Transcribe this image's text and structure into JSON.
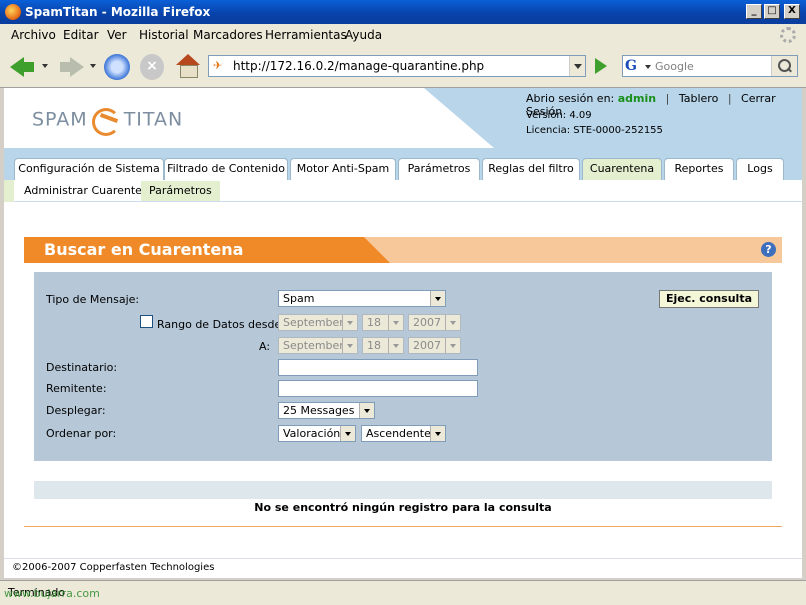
{
  "window": {
    "title": "SpamTitan - Mozilla Firefox",
    "minimize": "_",
    "maximize": "□",
    "close": "X"
  },
  "menu": {
    "items": [
      "Archivo",
      "Editar",
      "Ver",
      "Historial",
      "Marcadores",
      "Herramientas",
      "Ayuda"
    ]
  },
  "navigation": {
    "url": "http://172.16.0.2/manage-quarantine.php",
    "search_placeholder": "Google",
    "search_engine_letter": "G"
  },
  "header": {
    "logo_left": "SPAM",
    "logo_right": "TITAN",
    "session_label": "Abrio sesión en:",
    "user": "admin",
    "link_dashboard": "Tablero",
    "link_logout": "Cerrar Sesión",
    "version": "Versión: 4.09",
    "license": "Licencia: STE-0000-252155"
  },
  "tabs": [
    {
      "label": "Configuración de Sistema",
      "active": false
    },
    {
      "label": "Filtrado de Contenido",
      "active": false
    },
    {
      "label": "Motor Anti-Spam",
      "active": false
    },
    {
      "label": "Parámetros",
      "active": false
    },
    {
      "label": "Reglas del filtro",
      "active": false
    },
    {
      "label": "Cuarentena",
      "active": true
    },
    {
      "label": "Reportes",
      "active": false
    },
    {
      "label": "Logs",
      "active": false
    }
  ],
  "subtabs": [
    {
      "label": "Administrar Cuarentena",
      "active": true
    },
    {
      "label": "Parámetros",
      "active": false
    }
  ],
  "panel": {
    "title": "Buscar en Cuarentena",
    "help": "?"
  },
  "form": {
    "message_type_label": "Tipo de Mensaje:",
    "message_type_value": "Spam",
    "run_button": "Ejec. consulta",
    "date_range_label": "Rango de Datos desde:",
    "date_range_checked": false,
    "from_month": "September",
    "from_day": "18",
    "from_year": "2007",
    "to_label": "A:",
    "to_month": "September",
    "to_day": "18",
    "to_year": "2007",
    "recipient_label": "Destinatario:",
    "recipient_value": "",
    "sender_label": "Remitente:",
    "sender_value": "",
    "display_label": "Desplegar:",
    "display_value": "25 Messages",
    "sort_label": "Ordenar por:",
    "sort_field": "Valoración",
    "sort_order": "Ascendente"
  },
  "results": {
    "empty_message": "No se encontró ningún registro para la consulta"
  },
  "footer": {
    "copyright": "©2006-2007 Copperfasten Technologies"
  },
  "status": {
    "text": "Terminado",
    "watermark": "www.bujarra.com"
  },
  "colors": {
    "orange": "#f08a28",
    "header_blue": "#b8d5ea",
    "form_blue": "#b6c8d8",
    "active_tab": "#e4efcf",
    "user_green": "#1a8f1a"
  }
}
